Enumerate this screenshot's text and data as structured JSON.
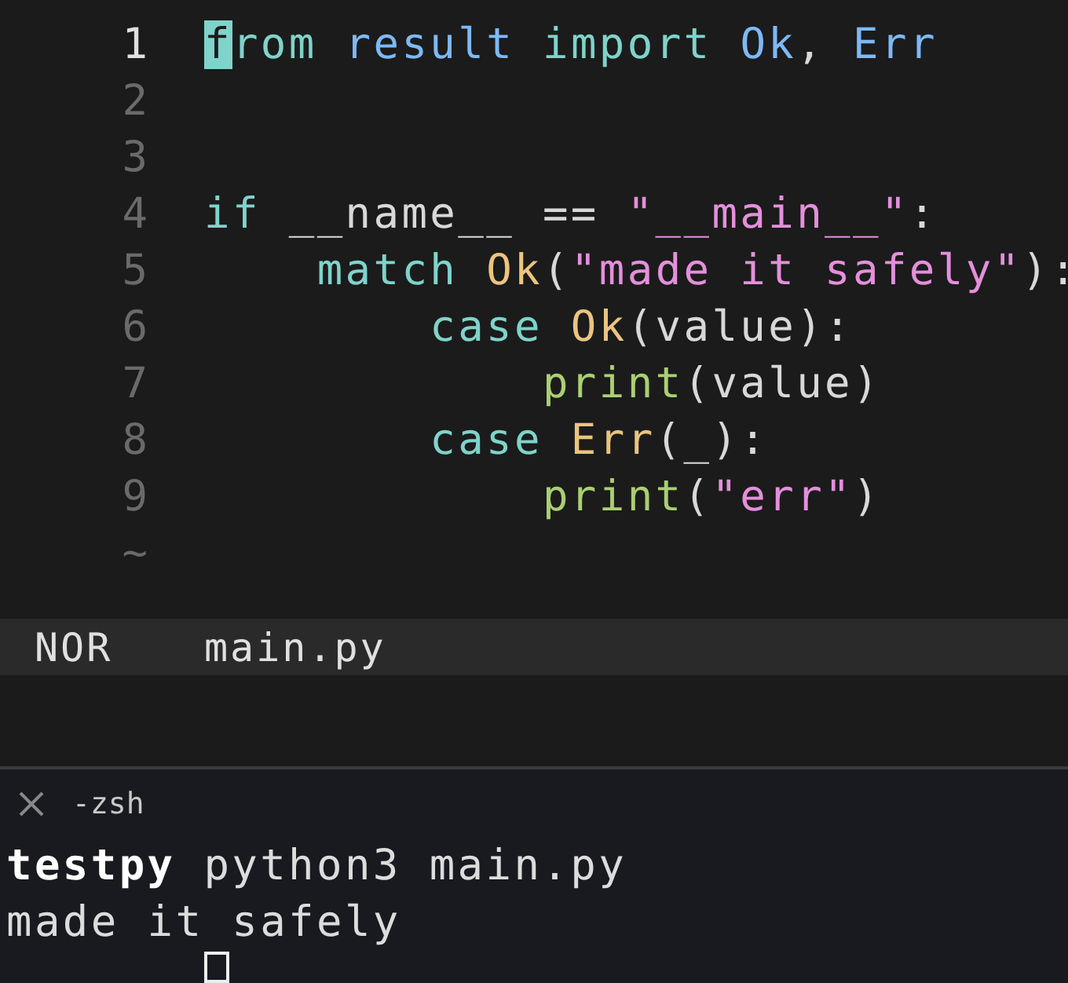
{
  "editor": {
    "lines": [
      {
        "number": "1",
        "current": true,
        "tokens": [
          {
            "kind": "cursor",
            "text": "f"
          },
          {
            "kind": "keyword",
            "text": "rom "
          },
          {
            "kind": "name",
            "text": "result "
          },
          {
            "kind": "keyword",
            "text": "import "
          },
          {
            "kind": "name",
            "text": "Ok"
          },
          {
            "kind": "plain",
            "text": ", "
          },
          {
            "kind": "name",
            "text": "Err"
          }
        ]
      },
      {
        "number": "2",
        "current": false
      },
      {
        "number": "3",
        "current": false
      },
      {
        "number": "4",
        "current": false,
        "tokens": [
          {
            "kind": "keyword",
            "text": "if"
          },
          {
            "kind": "plain",
            "text": " __name__ == "
          },
          {
            "kind": "string",
            "text": "\"__main__\""
          },
          {
            "kind": "plain",
            "text": ":"
          }
        ]
      },
      {
        "number": "5",
        "current": false,
        "tokens": [
          {
            "kind": "keyword",
            "text": "    match "
          },
          {
            "kind": "class",
            "text": "Ok"
          },
          {
            "kind": "plain",
            "text": "("
          },
          {
            "kind": "string",
            "text": "\"made it safely\""
          },
          {
            "kind": "plain",
            "text": "):"
          }
        ]
      },
      {
        "number": "6",
        "current": false,
        "tokens": [
          {
            "kind": "keyword",
            "text": "        case "
          },
          {
            "kind": "class",
            "text": "Ok"
          },
          {
            "kind": "plain",
            "text": "(value):"
          }
        ]
      },
      {
        "number": "7",
        "current": false,
        "tokens": [
          {
            "kind": "func",
            "text": "            print"
          },
          {
            "kind": "plain",
            "text": "(value)"
          }
        ]
      },
      {
        "number": "8",
        "current": false,
        "tokens": [
          {
            "kind": "keyword",
            "text": "        case "
          },
          {
            "kind": "class",
            "text": "Err"
          },
          {
            "kind": "plain",
            "text": "(_):"
          }
        ]
      },
      {
        "number": "9",
        "current": false,
        "tokens": [
          {
            "kind": "func",
            "text": "            print"
          },
          {
            "kind": "plain",
            "text": "("
          },
          {
            "kind": "string",
            "text": "\"err\""
          },
          {
            "kind": "plain",
            "text": ")"
          }
        ]
      },
      {
        "number": "~",
        "current": false
      }
    ]
  },
  "status_bar": {
    "mode": "NOR",
    "file": "main.py"
  },
  "terminal": {
    "tab": "-zsh",
    "prompt": "testpy",
    "command": "python3 main.py",
    "output": "made it safely"
  }
}
